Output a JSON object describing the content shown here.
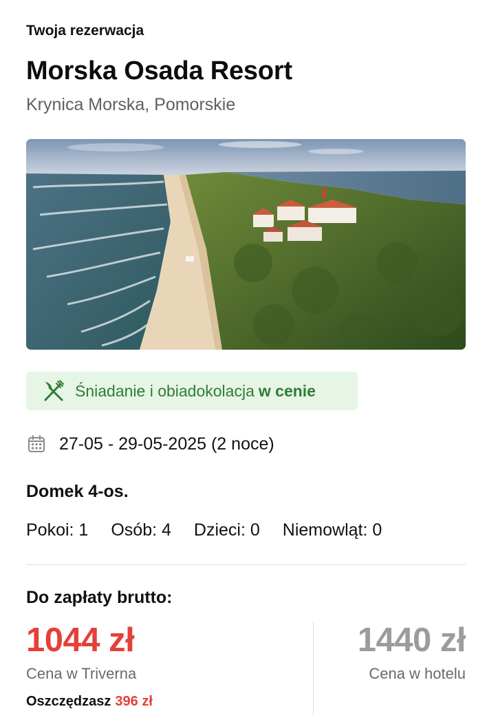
{
  "booking": {
    "eyebrow": "Twoja rezerwacja",
    "hotel_name": "Morska Osada Resort",
    "location": "Krynica Morska, Pomorskie"
  },
  "meal": {
    "icon": "fork-knife-icon",
    "text": "Śniadanie i obiadokolacja",
    "highlight": "w cenie",
    "color": "#2e7d32",
    "background": "#e6f5e6"
  },
  "stay": {
    "icon": "calendar-icon",
    "dates": "27-05 - 29-05-2025 (2 noce)",
    "room_type": "Domek 4-os."
  },
  "occupancy": [
    "Pokoi: 1",
    "Osób: 4",
    "Dzieci: 0",
    "Niemowląt: 0"
  ],
  "pricing": {
    "label": "Do zapłaty brutto:",
    "our_price": "1044 zł",
    "our_caption": "Cena w Triverna",
    "savings_label": "Oszczędzasz",
    "savings_amount": "396 zł",
    "hotel_price": "1440 zł",
    "hotel_caption": "Cena w hotelu",
    "accent_color": "#e5403a"
  }
}
